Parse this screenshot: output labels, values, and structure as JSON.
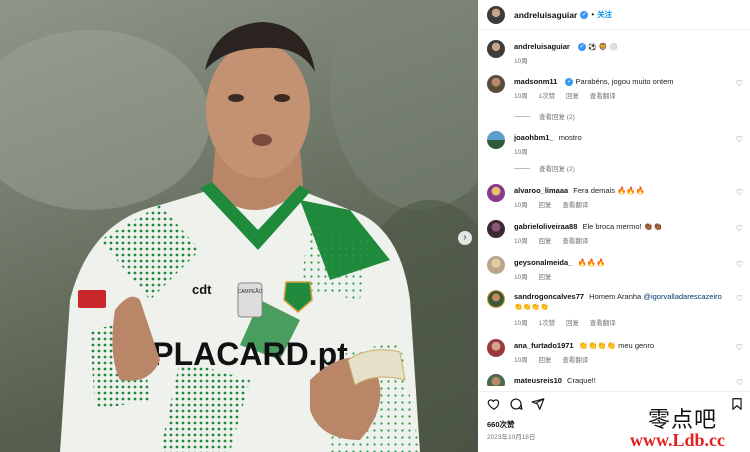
{
  "photo": {
    "sponsor_main": "PLACARD.pt",
    "sponsor_sleeve": "cdt",
    "logo_text": "CAMPEÃO",
    "next_arrow_icon": "chevron-right-icon"
  },
  "header": {
    "username": "andreluisaguiar",
    "separator": "•",
    "follow_label": "关注"
  },
  "caption": {
    "username": "andreluisaguiar",
    "emojis": "⚽ 🦁 ⚪",
    "time": "10周"
  },
  "comments": [
    {
      "user": "madsonm11",
      "verified": true,
      "text": "Parabéns, jogou muito ontem",
      "time": "10周",
      "likes": "1次赞",
      "reply": "回复",
      "translate": "查看翻译",
      "replies": "查看回复 (2)"
    },
    {
      "user": "joaohbm1_",
      "verified": false,
      "text": "mostro",
      "time": "10周",
      "likes": "",
      "reply": "",
      "translate": "",
      "replies": "查看回复 (2)"
    },
    {
      "user": "alvaroo_limaaa",
      "verified": false,
      "text": "Fera demais 🔥🔥🔥",
      "time": "10周",
      "likes": "",
      "reply": "回复",
      "translate": "查看翻译",
      "replies": ""
    },
    {
      "user": "gabrieloliveiraa88",
      "verified": false,
      "text": "Ele broca mermo! 👏🏾👏🏾",
      "time": "10周",
      "likes": "",
      "reply": "回复",
      "translate": "查看翻译",
      "replies": ""
    },
    {
      "user": "geysonalmeida_",
      "verified": false,
      "text": "🔥🔥🔥",
      "time": "10周",
      "likes": "",
      "reply": "回复",
      "translate": "",
      "replies": ""
    },
    {
      "user": "sandrogoncalves77",
      "verified": false,
      "text": "Homem Aranha",
      "mention": "@igorvalladarescazeiro",
      "text2": "👏👏👏👏",
      "time": "10周",
      "likes": "1次赞",
      "reply": "回复",
      "translate": "查看翻译",
      "replies": ""
    },
    {
      "user": "ana_furtado1971",
      "verified": false,
      "text": "👏👏👏👏 meu genro",
      "time": "10周",
      "likes": "",
      "reply": "回复",
      "translate": "查看翻译",
      "replies": ""
    },
    {
      "user": "mateusreis10",
      "verified": false,
      "text": "Craque!!",
      "time": "",
      "likes": "",
      "reply": "",
      "translate": "",
      "replies": ""
    }
  ],
  "footer": {
    "likes": "660次赞",
    "date": "2023年10月18日"
  },
  "watermark": {
    "cn": "零点吧",
    "url": "www.Ldb.cc"
  },
  "colors": {
    "accent": "#0095f6",
    "verified": "#3897f0",
    "kit_green": "#1f8a3c",
    "watermark_red": "#e0201f"
  }
}
